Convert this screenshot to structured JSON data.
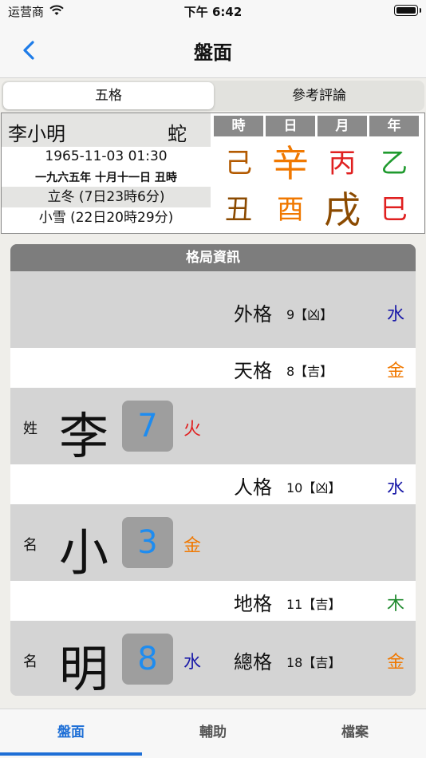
{
  "status": {
    "carrier": "运营商",
    "time": "下午 6:42"
  },
  "nav": {
    "title": "盤面"
  },
  "segments": {
    "active": "五格",
    "inactive": "參考評論"
  },
  "profile": {
    "name": "李小明",
    "zodiac": "蛇",
    "datetime": "1965-11-03 01:30",
    "lunar": "一九六五年 十月十一日 丑時",
    "term1": "立冬 (7日23時6分)",
    "term2": "小雪 (22日20時29分)"
  },
  "pillars": [
    {
      "head": "時",
      "stem": "己",
      "stem_color": "#b35a00",
      "branch": "丑",
      "branch_color": "#8b4a00"
    },
    {
      "head": "日",
      "stem": "辛",
      "stem_color": "#f07800",
      "branch": "酉",
      "branch_color": "#f07800"
    },
    {
      "head": "月",
      "stem": "丙",
      "stem_color": "#e02020",
      "branch": "戌",
      "branch_color": "#8b4a00"
    },
    {
      "head": "年",
      "stem": "乙",
      "stem_color": "#1f9a2e",
      "branch": "巳",
      "branch_color": "#e02020"
    }
  ],
  "pattern": {
    "title": "格局資訊",
    "outer": {
      "label": "外格",
      "value": "9【凶】",
      "element": "水",
      "color": "#1a1aa8"
    },
    "heaven": {
      "label": "天格",
      "value": "8【吉】",
      "element": "金",
      "color": "#f07800"
    },
    "human": {
      "label": "人格",
      "value": "10【凶】",
      "element": "水",
      "color": "#1a1aa8"
    },
    "earth": {
      "label": "地格",
      "value": "11【吉】",
      "element": "木",
      "color": "#1f8a2e"
    },
    "total": {
      "label": "總格",
      "value": "18【吉】",
      "element": "金",
      "color": "#f07800"
    },
    "chars": [
      {
        "kind": "姓",
        "char": "李",
        "strokes": "7",
        "element": "火",
        "color": "#e02020"
      },
      {
        "kind": "名",
        "char": "小",
        "strokes": "3",
        "element": "金",
        "color": "#f07800"
      },
      {
        "kind": "名",
        "char": "明",
        "strokes": "8",
        "element": "水",
        "color": "#1a1aa8"
      }
    ]
  },
  "tabs": [
    "盤面",
    "輔助",
    "檔案"
  ]
}
